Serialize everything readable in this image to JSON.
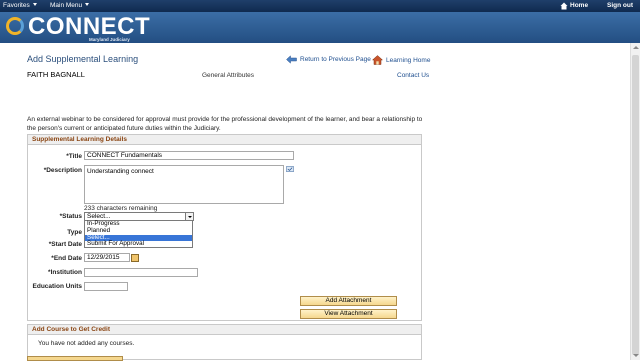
{
  "nav": {
    "favorites": "Favorites",
    "main_menu": "Main Menu",
    "home": "Home",
    "sign_out": "Sign out"
  },
  "banner": {
    "logo": "CONNECT",
    "sub": "Maryland Judiciary"
  },
  "header": {
    "title": "Add Supplemental Learning",
    "learner": "FAITH BAGNALL",
    "general_attributes": "General Attributes",
    "return_link": "Return to Previous Page",
    "learning_home": "Learning Home",
    "contact": "Contact Us"
  },
  "notice": "An external webinar to be considered for approval must provide for the professional development of the learner, and bear a relationship to the person's current or anticipated future duties within the Judiciary.",
  "details": {
    "heading": "Supplemental Learning Details",
    "title_label": "*Title",
    "title_value": "CONNECT Fundamentals",
    "description_label": "*Description",
    "description_value": "Understanding connect",
    "remaining": "233 characters remaining",
    "status_label": "*Status",
    "status_value": "Select...",
    "status_options": [
      "In-Progress",
      "Planned",
      "Select...",
      "Submit For Approval"
    ],
    "type_label": "Type",
    "start_date_label": "*Start Date",
    "end_date_label": "*End Date",
    "end_date_value": "12/29/2015",
    "institution_label": "*Institution",
    "education_units_label": "Education Units",
    "add_attachment": "Add Attachment",
    "view_attachment": "View Attachment"
  },
  "add_course": {
    "heading": "Add Course to Get Credit",
    "message": "You have not added any courses."
  },
  "colors": {
    "nav_bg": "#163564",
    "banner_bg": "#2f5f96",
    "section_heading": "#8a4513",
    "link": "#1f4f8f",
    "selected_option": "#3875d7"
  }
}
